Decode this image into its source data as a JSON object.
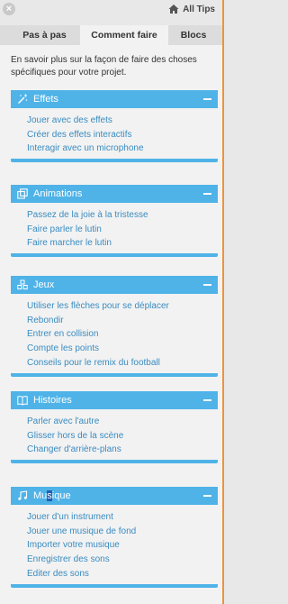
{
  "header": {
    "all_tips_label": "All Tips"
  },
  "tabs": [
    {
      "label": "Pas à pas"
    },
    {
      "label": "Comment faire"
    },
    {
      "label": "Blocs"
    }
  ],
  "intro": "En savoir plus sur la façon de faire des choses spécifiques pour votre projet.",
  "sections": [
    {
      "title": "Effets",
      "icon": "magic-wand-icon",
      "links": [
        "Jouer avec des effets",
        "Créer des effets interactifs",
        "Interagir avec un microphone"
      ]
    },
    {
      "title": "Animations",
      "icon": "animation-frames-icon",
      "links": [
        "Passez de la joie à la tristesse",
        "Faire parler le lutin",
        "Faire marcher le lutin"
      ]
    },
    {
      "title": "Jeux",
      "icon": "game-blocks-icon",
      "links": [
        "Utiliser les flèches pour se déplacer",
        "Rebondir",
        "Entrer en collision",
        "Compte les points",
        "Conseils pour le remix du football"
      ]
    },
    {
      "title": "Histoires",
      "icon": "book-icon",
      "links": [
        "Parler avec l'autre",
        "Glisser hors de la scène",
        "Changer d'arrière-plans"
      ]
    },
    {
      "title": "Musique",
      "title_parts": [
        "Mu",
        "s",
        "ique"
      ],
      "icon": "music-note-icon",
      "links": [
        "Jouer d'un instrument",
        "Jouer une musique de fond",
        "Importer votre musique",
        "Enregistrer des sons",
        "Editer des sons"
      ]
    }
  ],
  "colors": {
    "accent": "#4fb3e8",
    "link": "#3a8cc0",
    "panel_border": "#f0923a"
  }
}
